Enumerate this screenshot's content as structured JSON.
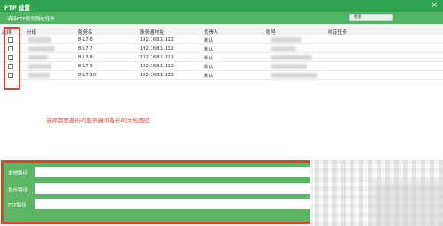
{
  "window": {
    "title": "FTP 设置",
    "close_glyph": "×"
  },
  "toolbar": {
    "label": "请设FTP服务器的任务",
    "search_placeholder": "搜索"
  },
  "table": {
    "columns": [
      "选择",
      "分组",
      "服务名",
      "服务器地址",
      "负责人",
      "账号",
      "绑定任务"
    ],
    "rows": [
      {
        "group": "",
        "service": "B-L7-6",
        "address": "192.168.1.112",
        "owner": "默认",
        "account": ""
      },
      {
        "group": "",
        "service": "B-L7-7",
        "address": "192.168.1.112",
        "owner": "默认",
        "account": ""
      },
      {
        "group": "",
        "service": "B-L7-8",
        "address": "192.168.1.112",
        "owner": "默认",
        "account": ""
      },
      {
        "group": "",
        "service": "B-L7-9",
        "address": "192.168.1.112",
        "owner": "默认",
        "account": ""
      },
      {
        "group": "",
        "service": "B-L7-10",
        "address": "192.168.1.112",
        "owner": "默认",
        "account": ""
      }
    ]
  },
  "annotation": "选择需要备份的服务器和备份的文档路径",
  "form": {
    "fields": [
      {
        "label": "本地路径:"
      },
      {
        "label": "备份路径:"
      },
      {
        "label": "FTP路径:"
      }
    ]
  },
  "colors": {
    "titlebar": "#2fa24f",
    "toolbar": "#50b464",
    "highlight": "#e0403a",
    "form_border": "#cc4b2a",
    "form_bg": "#5cb665"
  }
}
